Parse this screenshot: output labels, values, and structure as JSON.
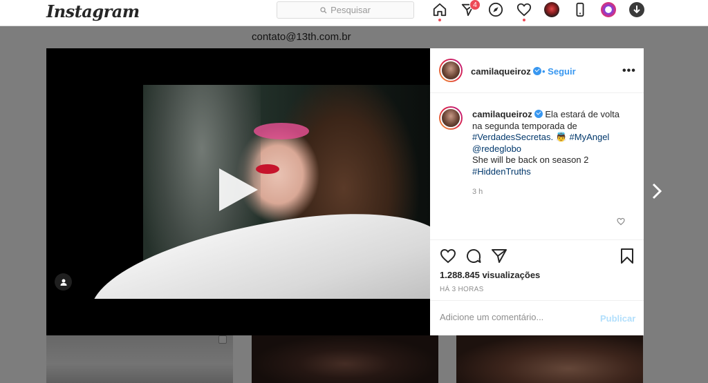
{
  "nav": {
    "logo": "Instagram",
    "search_placeholder": "Pesquisar",
    "activity_badge": "4"
  },
  "background": {
    "bio_email": "contato@13th.com.br"
  },
  "post": {
    "username": "camilaqueiroz",
    "follow_label": "Seguir",
    "more_label": "•••",
    "caption": {
      "line1": "Ela estará de volta",
      "line2": "na segunda temporada de",
      "hashtag1": "#VerdadesSecretas.",
      "emoji": "👼",
      "hashtag2": "#MyAngel",
      "mention": "@redeglobo",
      "line_en": "She will be back on season 2",
      "hashtag3": "#HiddenTruths"
    },
    "time_ago": "3 h",
    "views": "1.288.845 visualizações",
    "posted": "HÁ 3 HORAS",
    "comment_placeholder": "Adicione um comentário...",
    "publish_label": "Publicar"
  },
  "colors": {
    "link_blue": "#3897f0",
    "hashtag": "#00376b",
    "badge_red": "#ed4956",
    "publish_disabled": "#b2dffc"
  }
}
